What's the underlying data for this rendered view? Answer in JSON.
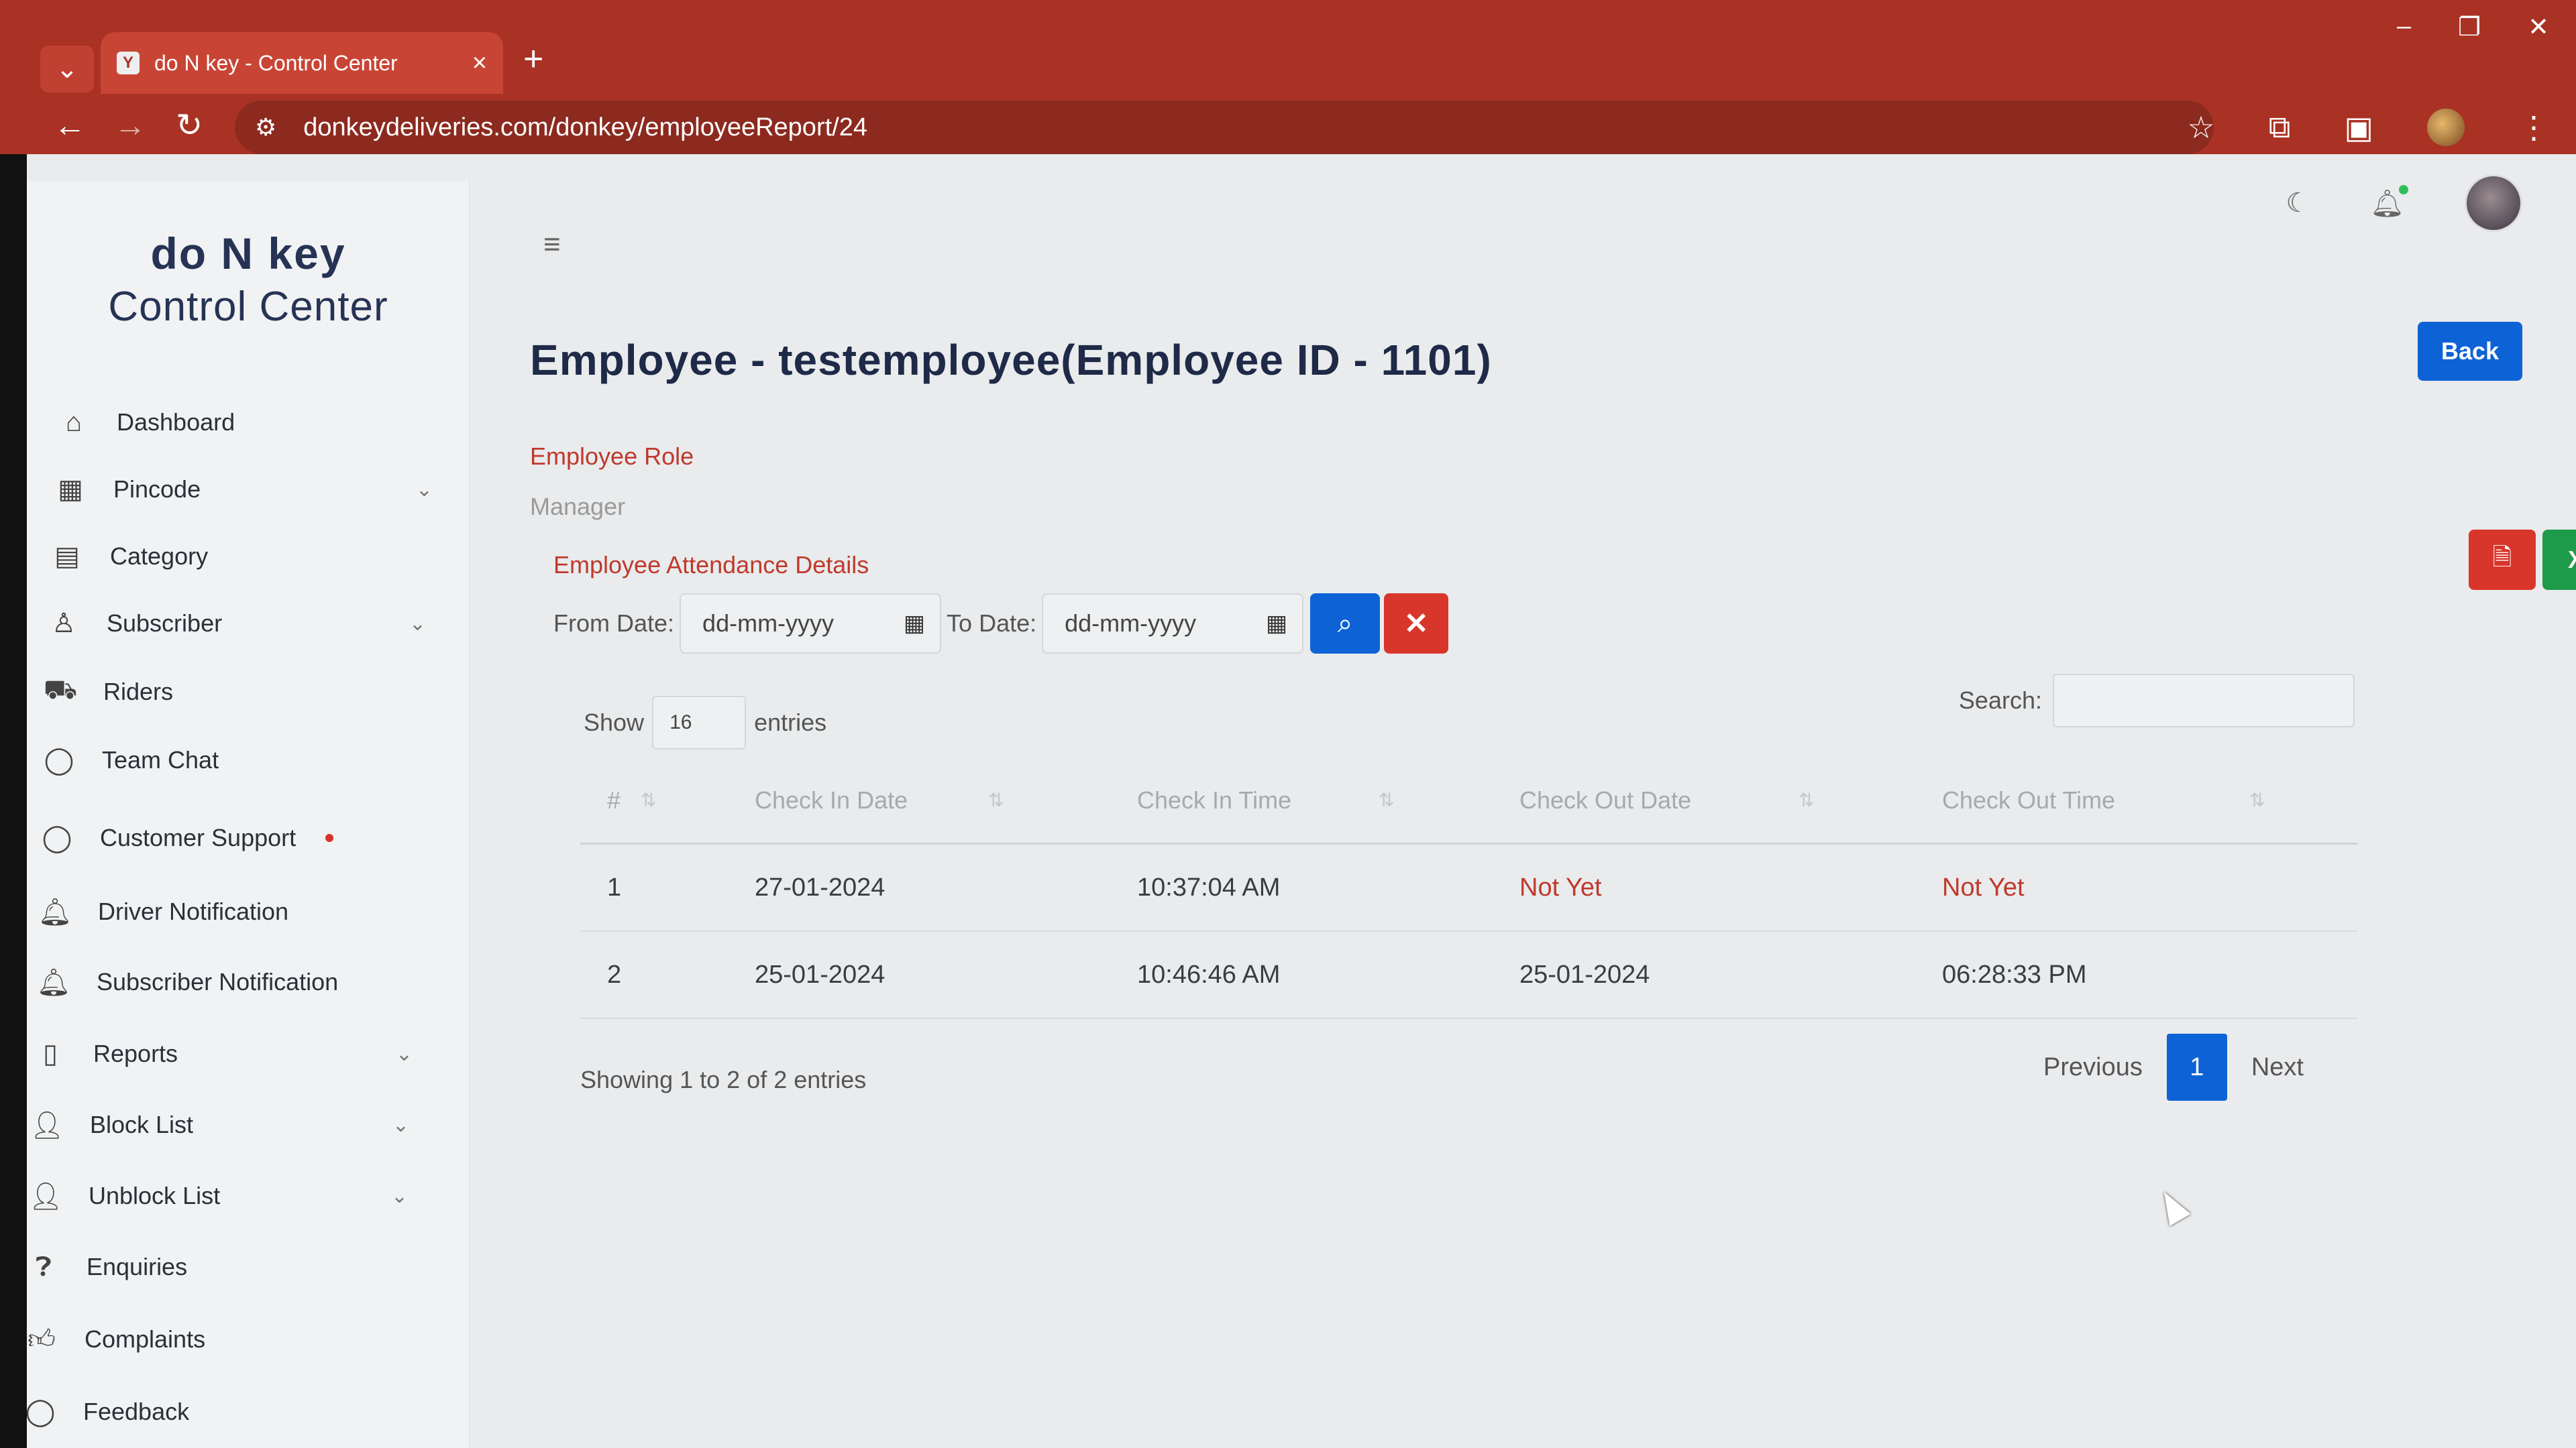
{
  "browser": {
    "tab_title": "do N key - Control Center",
    "tab_favicon": "Y",
    "url": "donkeydeliveries.com/donkey/employeeReport/24",
    "icons": {
      "tab_menu": "chevron-down-icon",
      "close": "close-icon",
      "new_tab": "plus-icon",
      "back": "arrow-left-icon",
      "forward": "arrow-right-icon",
      "reload": "reload-icon",
      "site_info": "tune-icon",
      "bookmark": "star-icon",
      "extensions": "puzzle-icon",
      "sidepanel": "sidepanel-icon",
      "menu": "kebab-icon"
    }
  },
  "brand": {
    "top": "do N key",
    "sub": "Control Center"
  },
  "sidebar": {
    "items": [
      {
        "label": "Dashboard",
        "icon": "home-icon"
      },
      {
        "label": "Pincode",
        "icon": "grid-icon",
        "chevron": true
      },
      {
        "label": "Category",
        "icon": "category-icon"
      },
      {
        "label": "Subscriber",
        "icon": "badge-icon",
        "chevron": true
      },
      {
        "label": "Riders",
        "icon": "truck-icon"
      },
      {
        "label": "Team Chat",
        "icon": "chat-icon"
      },
      {
        "label": "Customer Support",
        "icon": "chat-icon",
        "dot": true
      },
      {
        "label": "Driver Notification",
        "icon": "bell-icon"
      },
      {
        "label": "Subscriber Notification",
        "icon": "bell-dot-icon"
      },
      {
        "label": "Reports",
        "icon": "clipboard-icon",
        "chevron": true
      },
      {
        "label": "Block List",
        "icon": "user-x-icon",
        "chevron": true
      },
      {
        "label": "Unblock List",
        "icon": "user-check-icon",
        "chevron": true
      },
      {
        "label": "Enquiries",
        "icon": "question-icon"
      },
      {
        "label": "Complaints",
        "icon": "thumbs-up-icon"
      },
      {
        "label": "Feedback",
        "icon": "chat-icon"
      }
    ]
  },
  "header": {
    "icons": [
      "moon-icon",
      "bell-icon",
      "avatar"
    ]
  },
  "page": {
    "title": "Employee - testemployee(Employee ID - 1101)",
    "back_label": "Back",
    "role_label": "Employee Role",
    "role_value": "Manager",
    "attendance_title": "Employee Attendance Details",
    "from_label": "From Date:",
    "to_label": "To Date:",
    "date_placeholder": "dd-mm-yyyy",
    "show_label": "Show",
    "show_value": "16",
    "entries_label": "entries",
    "search_label": "Search:",
    "export_icons": [
      "pdf-icon",
      "excel-icon"
    ]
  },
  "table": {
    "headers": [
      "#",
      "Check In Date",
      "Check In Time",
      "Check Out Date",
      "Check Out Time"
    ],
    "rows": [
      {
        "num": "1",
        "in_date": "27-01-2024",
        "in_time": "10:37:04 AM",
        "out_date": "Not Yet",
        "out_time": "Not Yet"
      },
      {
        "num": "2",
        "in_date": "25-01-2024",
        "in_time": "10:46:46 AM",
        "out_date": "25-01-2024",
        "out_time": "06:28:33 PM"
      }
    ]
  },
  "pagination": {
    "info": "Showing 1 to 2 of 2 entries",
    "previous": "Previous",
    "current": "1",
    "next": "Next"
  },
  "colors": {
    "chrome": "#a93224",
    "primary": "#0d63d6",
    "danger": "#d9362b",
    "success": "#1d9b4a",
    "accent_text": "#c0392b"
  }
}
